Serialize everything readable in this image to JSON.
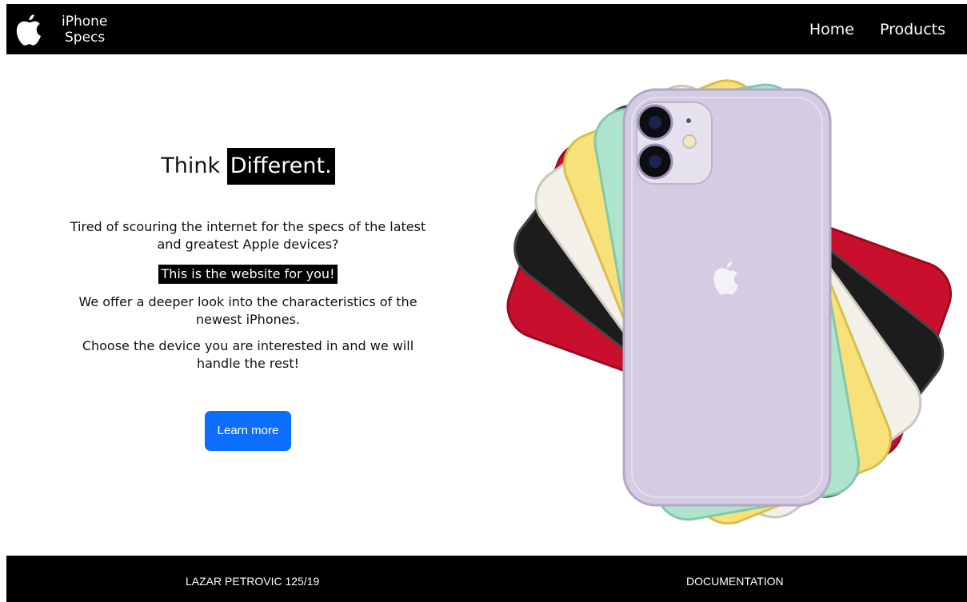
{
  "nav": {
    "brand_line1": "iPhone",
    "brand_line2": "Specs",
    "links": [
      "Home",
      "Products"
    ],
    "logo_icon": "apple-logo-icon"
  },
  "hero": {
    "headline_plain": "Think",
    "headline_highlight": "Different.",
    "paragraph1": "Tired of scouring the internet for the specs of the latest and greatest Apple devices?",
    "highlight_line": "This is the website for you!",
    "paragraph2": "We offer a deeper look into the characteristics of the newest iPhones.",
    "paragraph3": "Choose the device you are interested in and we will handle the rest!",
    "button_label": "Learn more",
    "button_color": "#0d6efd",
    "image": "iphone-11-color-fan-image",
    "phone_colors": [
      "#c8102e",
      "#1c1c1c",
      "#f2f0e8",
      "#f7e27a",
      "#aee4cc",
      "#d4cde2"
    ]
  },
  "footer": {
    "left_text": "LAZAR PETROVIC 125/19",
    "right_text": "DOCUMENTATION"
  }
}
